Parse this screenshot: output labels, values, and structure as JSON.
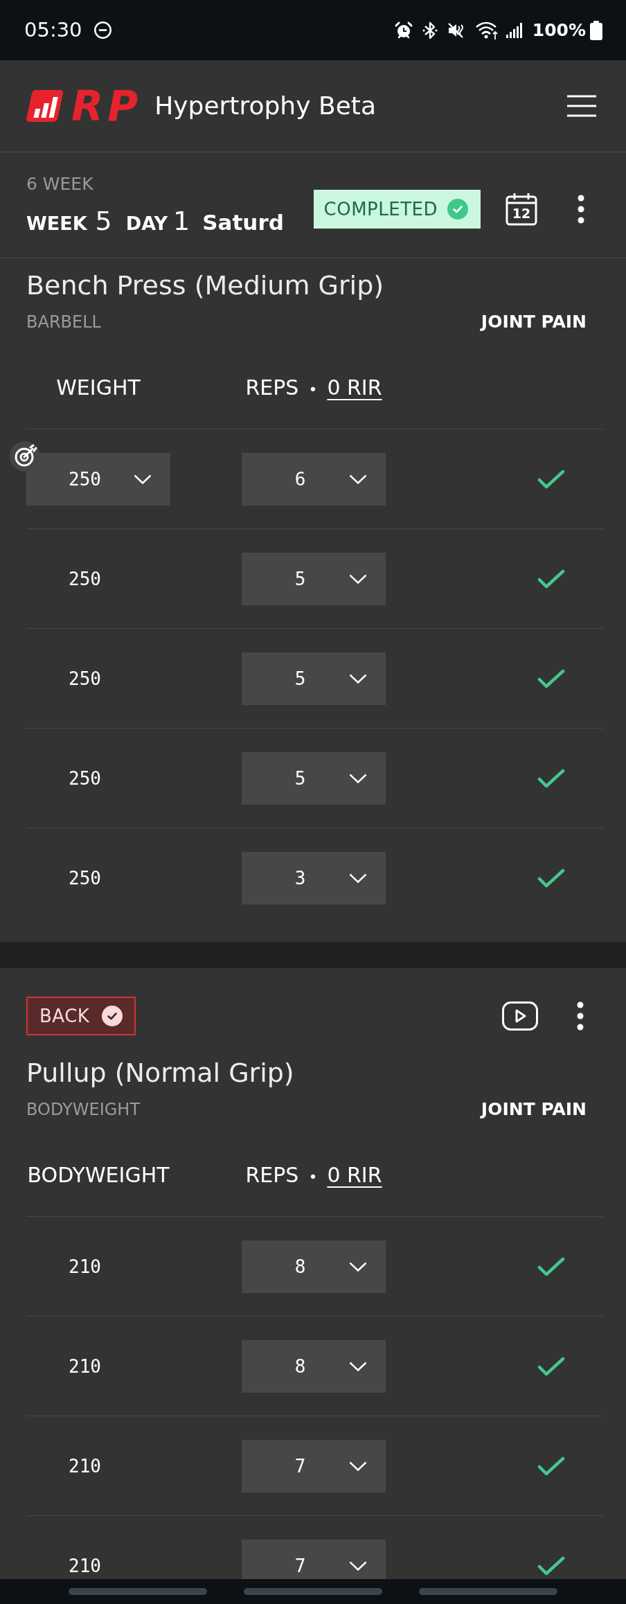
{
  "status_bar": {
    "time": "05:30",
    "battery": "100%"
  },
  "header": {
    "logo": "RP",
    "title": "Hypertrophy Beta"
  },
  "workout": {
    "program": "6 WEEK",
    "week_label": "WEEK",
    "week": "5",
    "day_label": "DAY",
    "day": "1",
    "weekday": "Saturd",
    "status": {
      "label": "COMPLETED",
      "completed": true
    },
    "calendar_day": "12"
  },
  "exercises": [
    {
      "name": "Bench Press (Medium Grip)",
      "equipment": "BARBELL",
      "joint_pain": "JOINT PAIN",
      "columns": {
        "load": "WEIGHT",
        "reps": "REPS",
        "separator": "•",
        "rir": "0 RIR"
      },
      "sets": [
        {
          "kind": "dropdown",
          "weight": "250",
          "reps": "6",
          "logged": true
        },
        {
          "kind": "plain",
          "weight": "250",
          "reps": "5",
          "logged": true
        },
        {
          "kind": "plain",
          "weight": "250",
          "reps": "5",
          "logged": true
        },
        {
          "kind": "plain",
          "weight": "250",
          "reps": "5",
          "logged": true
        },
        {
          "kind": "plain",
          "weight": "250",
          "reps": "3",
          "logged": true
        }
      ]
    },
    {
      "muscle_group": {
        "label": "BACK",
        "done": true
      },
      "name": "Pullup (Normal Grip)",
      "equipment": "BODYWEIGHT",
      "joint_pain": "JOINT PAIN",
      "columns": {
        "load": "BODYWEIGHT",
        "reps": "REPS",
        "separator": "•",
        "rir": "0 RIR"
      },
      "sets": [
        {
          "kind": "plain",
          "weight": "210",
          "reps": "8",
          "logged": true
        },
        {
          "kind": "plain",
          "weight": "210",
          "reps": "8",
          "logged": true
        },
        {
          "kind": "plain",
          "weight": "210",
          "reps": "7",
          "logged": true
        },
        {
          "kind": "plain",
          "weight": "210",
          "reps": "7",
          "logged": true
        }
      ]
    }
  ]
}
